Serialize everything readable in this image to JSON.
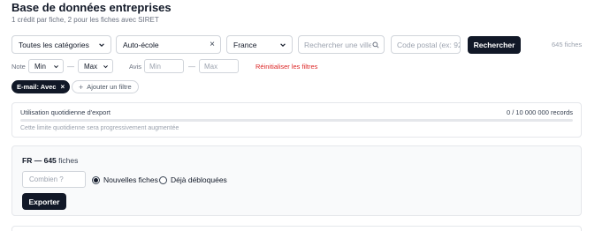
{
  "header": {
    "title": "Base de données entreprises",
    "subtitle": "1 crédit par fiche, 2 pour les fiches avec SIRET"
  },
  "filters": {
    "category": "Toutes les catégories",
    "activity": "Auto-école",
    "activity_clear": "×",
    "country": "France",
    "city_placeholder": "Rechercher une ville...",
    "postal_placeholder": "Code postal (ex: 92...",
    "search_label": "Rechercher",
    "result_count": "645 fiches"
  },
  "rating": {
    "note_label": "Note",
    "min": "Min",
    "separator": "—",
    "max": "Max",
    "reviews_label": "Avis",
    "reviews_min_placeholder": "Min",
    "reviews_max_placeholder": "Max",
    "reset_label": "Réinitialiser les filtres"
  },
  "chips": {
    "email_label": "E-mail: Avec",
    "email_close": "×",
    "add_label": "Ajouter un filtre",
    "add_prefix": "+"
  },
  "quota": {
    "title": "Utilisation quotidienne d'export",
    "usage": "0 / 10 000 000 records",
    "progress": 0,
    "note": "Cette limite quotidienne sera progressivement augmentée"
  },
  "export": {
    "country_code": "FR",
    "dash": "—",
    "count": "645",
    "unit": "fiches",
    "quantity_placeholder": "Combien ?",
    "option_new": "Nouvelles fiches",
    "option_unlocked": "Déjà débloquées",
    "selected_option": "new",
    "button_label": "Exporter"
  },
  "colors": {
    "primary": "#111827",
    "danger": "#dc2626",
    "muted": "#6b7280",
    "border": "#d1d5db"
  }
}
